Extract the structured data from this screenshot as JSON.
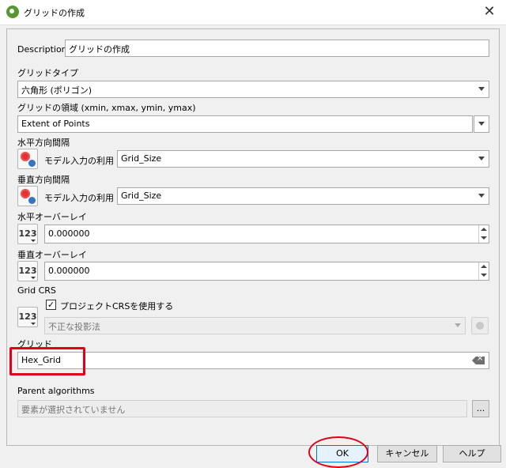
{
  "window": {
    "title": "グリッドの作成",
    "close_symbol": "✕"
  },
  "description": {
    "label": "Description",
    "value": "グリッドの作成"
  },
  "grid_type": {
    "label": "グリッドタイプ",
    "value": "六角形 (ポリゴン)"
  },
  "grid_extent": {
    "label": "グリッドの領域 (xmin, xmax, ymin, ymax)",
    "value": "Extent of Points"
  },
  "h_spacing": {
    "label": "水平方向間隔",
    "mode_label": "モデル入力の利用",
    "value": "Grid_Size"
  },
  "v_spacing": {
    "label": "垂直方向間隔",
    "mode_label": "モデル入力の利用",
    "value": "Grid_Size"
  },
  "h_overlay": {
    "label": "水平オーバーレイ",
    "type_icon": "123",
    "value": "0.000000"
  },
  "v_overlay": {
    "label": "垂直オーバーレイ",
    "type_icon": "123",
    "value": "0.000000"
  },
  "grid_crs": {
    "label": "Grid CRS",
    "type_icon": "123",
    "checkbox_label": "プロジェクトCRSを使用する",
    "checked": true,
    "check_mark": "✓",
    "crs_value": "不正な投影法"
  },
  "grid_output": {
    "label": "グリッド",
    "value": "Hex_Grid"
  },
  "parent_algorithms": {
    "label": "Parent algorithms",
    "placeholder": "要素が選択されていません",
    "browse_label": "..."
  },
  "buttons": {
    "ok": "OK",
    "cancel": "キャンセル",
    "help": "ヘルプ"
  },
  "colors": {
    "highlight": "#e0001a",
    "qgis_green": "#589632"
  }
}
